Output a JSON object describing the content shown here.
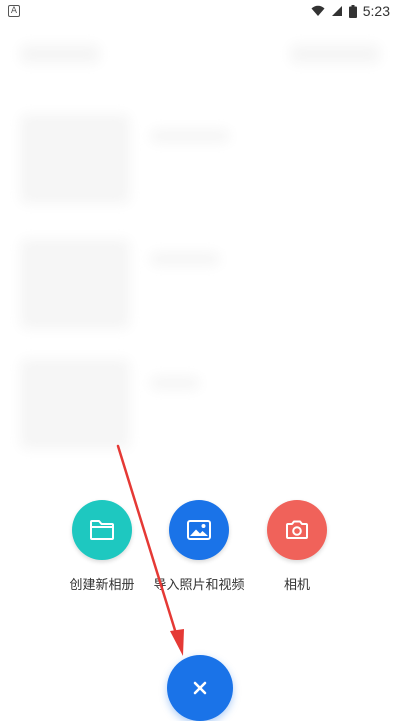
{
  "status_bar": {
    "time": "5:23",
    "icons": [
      "wifi-icon",
      "signal-icon",
      "battery-icon"
    ]
  },
  "actions": [
    {
      "label": "创建新相册",
      "icon": "folder-icon",
      "color": "#1ec8c0"
    },
    {
      "label": "导入照片和视频",
      "icon": "image-icon",
      "color": "#1a73e8"
    },
    {
      "label": "相机",
      "icon": "camera-icon",
      "color": "#f0625a"
    }
  ],
  "close_button": {
    "icon": "close-icon",
    "color": "#1a73e8"
  },
  "annotation": {
    "arrow_color": "#e53935"
  }
}
